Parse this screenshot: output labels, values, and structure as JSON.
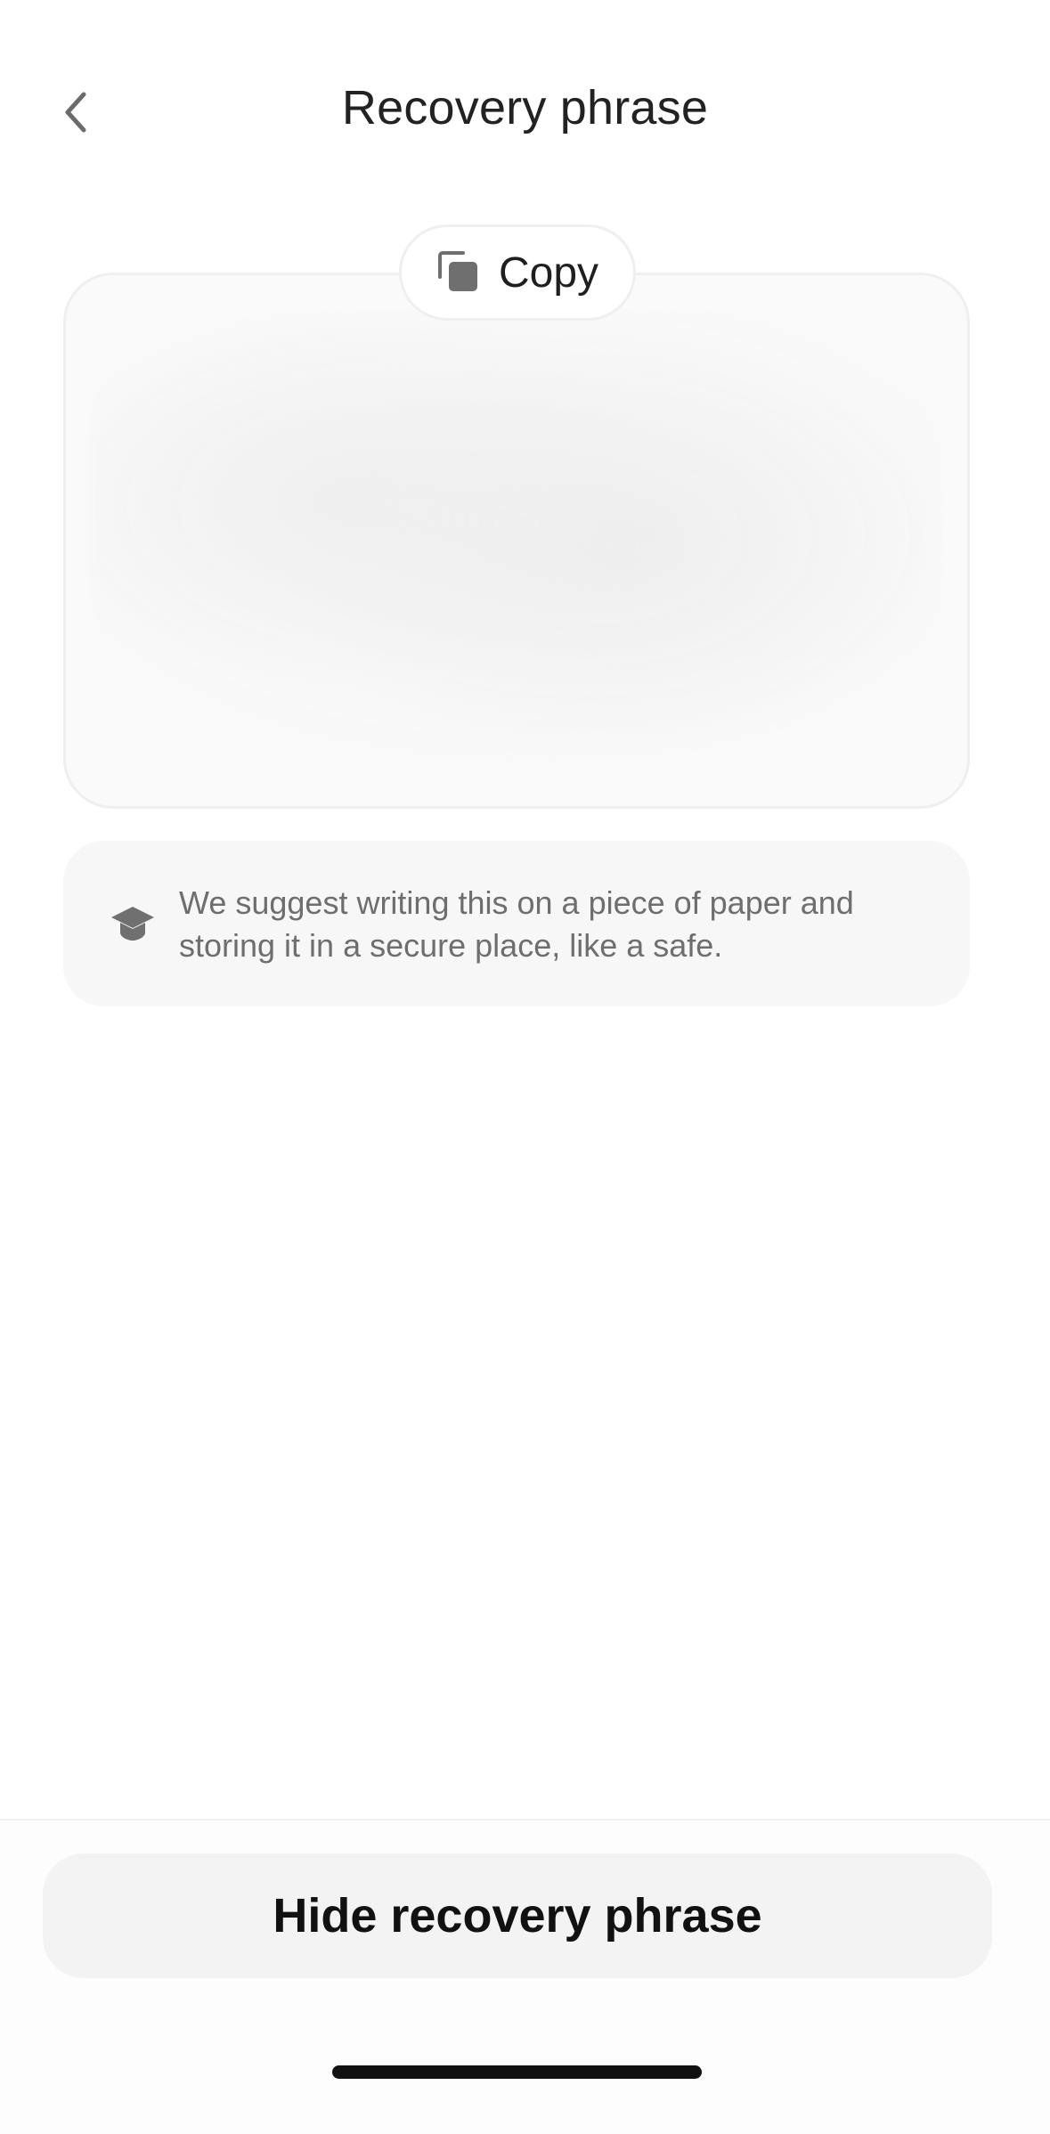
{
  "header": {
    "title": "Recovery phrase",
    "back_icon": "chevron-left-icon"
  },
  "phrase_card": {
    "state": "blurred",
    "copy_button": {
      "label": "Copy",
      "icon": "copy-icon"
    }
  },
  "tip": {
    "icon": "graduation-cap-icon",
    "text": "We suggest writing this on a piece of paper and storing it in a secure place, like a safe."
  },
  "footer": {
    "hide_button_label": "Hide recovery phrase"
  },
  "colors": {
    "background": "#ffffff",
    "card_border": "#efefef",
    "tip_background": "#f7f7f7",
    "button_background": "#f3f3f3",
    "text_primary": "#1f1f1f",
    "text_secondary": "#6e6e6e"
  }
}
